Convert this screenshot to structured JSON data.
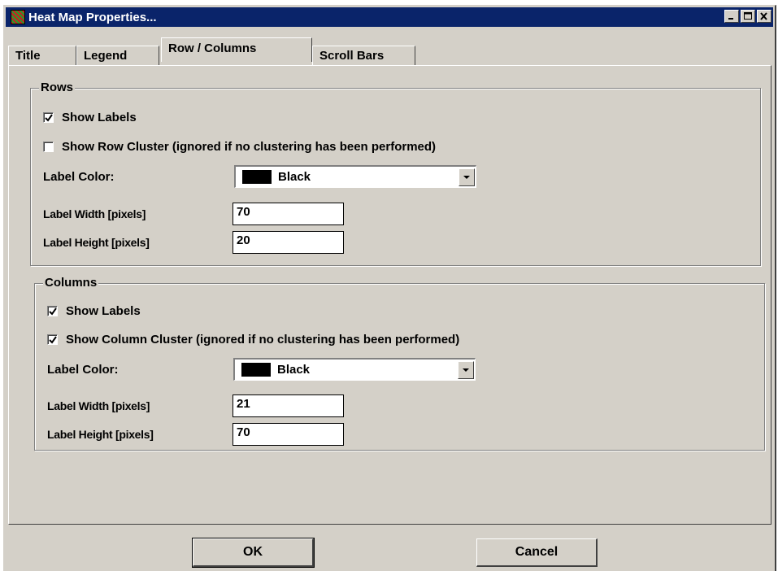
{
  "window": {
    "title": "Heat Map Properties..."
  },
  "tabs": [
    "Title",
    "Legend",
    "Row / Columns",
    "Scroll Bars"
  ],
  "active_tab": "Row / Columns",
  "rows": {
    "group_title": "Rows",
    "show_labels": {
      "label": "Show Labels",
      "checked": true
    },
    "show_cluster": {
      "label": "Show Row Cluster (ignored if no clustering has been performed)",
      "checked": false
    },
    "label_color": {
      "label": "Label Color:",
      "value": "Black",
      "swatch": "#000000"
    },
    "label_width": {
      "label": "Label Width [pixels]",
      "value": "70"
    },
    "label_height": {
      "label": "Label Height [pixels]",
      "value": "20"
    }
  },
  "columns": {
    "group_title": "Columns",
    "show_labels": {
      "label": "Show Labels",
      "checked": true
    },
    "show_cluster": {
      "label": "Show Column Cluster (ignored if no clustering has been performed)",
      "checked": true
    },
    "label_color": {
      "label": "Label Color:",
      "value": "Black",
      "swatch": "#000000"
    },
    "label_width": {
      "label": "Label Width [pixels]",
      "value": "21"
    },
    "label_height": {
      "label": "Label Height [pixels]",
      "value": "70"
    }
  },
  "buttons": {
    "ok": "OK",
    "cancel": "Cancel"
  },
  "icons": {
    "app": "heatmap-icon",
    "minimize": "minimize-icon",
    "maximize": "maximize-icon",
    "close": "close-icon",
    "dropdown": "chevron-down-icon",
    "check": "check-icon"
  },
  "colors": {
    "titlebar": "#0a246a",
    "face": "#d4d0c8"
  }
}
